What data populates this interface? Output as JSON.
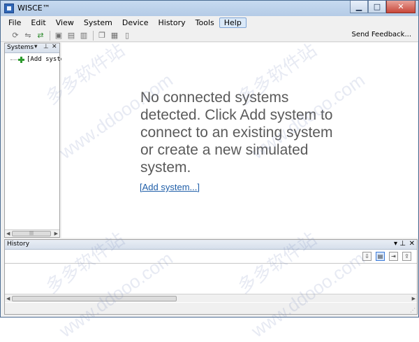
{
  "window": {
    "title": "WISCE™",
    "controls": {
      "minimize": "▁",
      "maximize": "□",
      "close": "✕"
    }
  },
  "menubar": {
    "items": [
      {
        "label": "File",
        "active": false
      },
      {
        "label": "Edit",
        "active": false
      },
      {
        "label": "View",
        "active": false
      },
      {
        "label": "System",
        "active": false
      },
      {
        "label": "Device",
        "active": false
      },
      {
        "label": "History",
        "active": false
      },
      {
        "label": "Tools",
        "active": false
      },
      {
        "label": "Help",
        "active": true
      }
    ]
  },
  "toolbar": {
    "icons": [
      "refresh-icon",
      "disconnect-icon",
      "connect-icon",
      "register-icon",
      "read-icon",
      "write-icon",
      "copy-icon",
      "grid-icon",
      "document-icon"
    ],
    "send_feedback": "Send Feedback..."
  },
  "systems_panel": {
    "title": "Systems",
    "tree_item": "[Add syste"
  },
  "main": {
    "message": "No connected systems detected. Click Add system to connect to an existing system or create a new simulated system.",
    "add_link": "[Add system...]"
  },
  "history_panel": {
    "title": "History"
  },
  "watermark": {
    "text_cn": "多多软件站",
    "text_url": "www.ddooo.com"
  },
  "colors": {
    "title_bar": "#b9cfe9",
    "link": "#1f5ea8",
    "message_text": "#5a5a5a",
    "close_button": "#c8473a"
  }
}
